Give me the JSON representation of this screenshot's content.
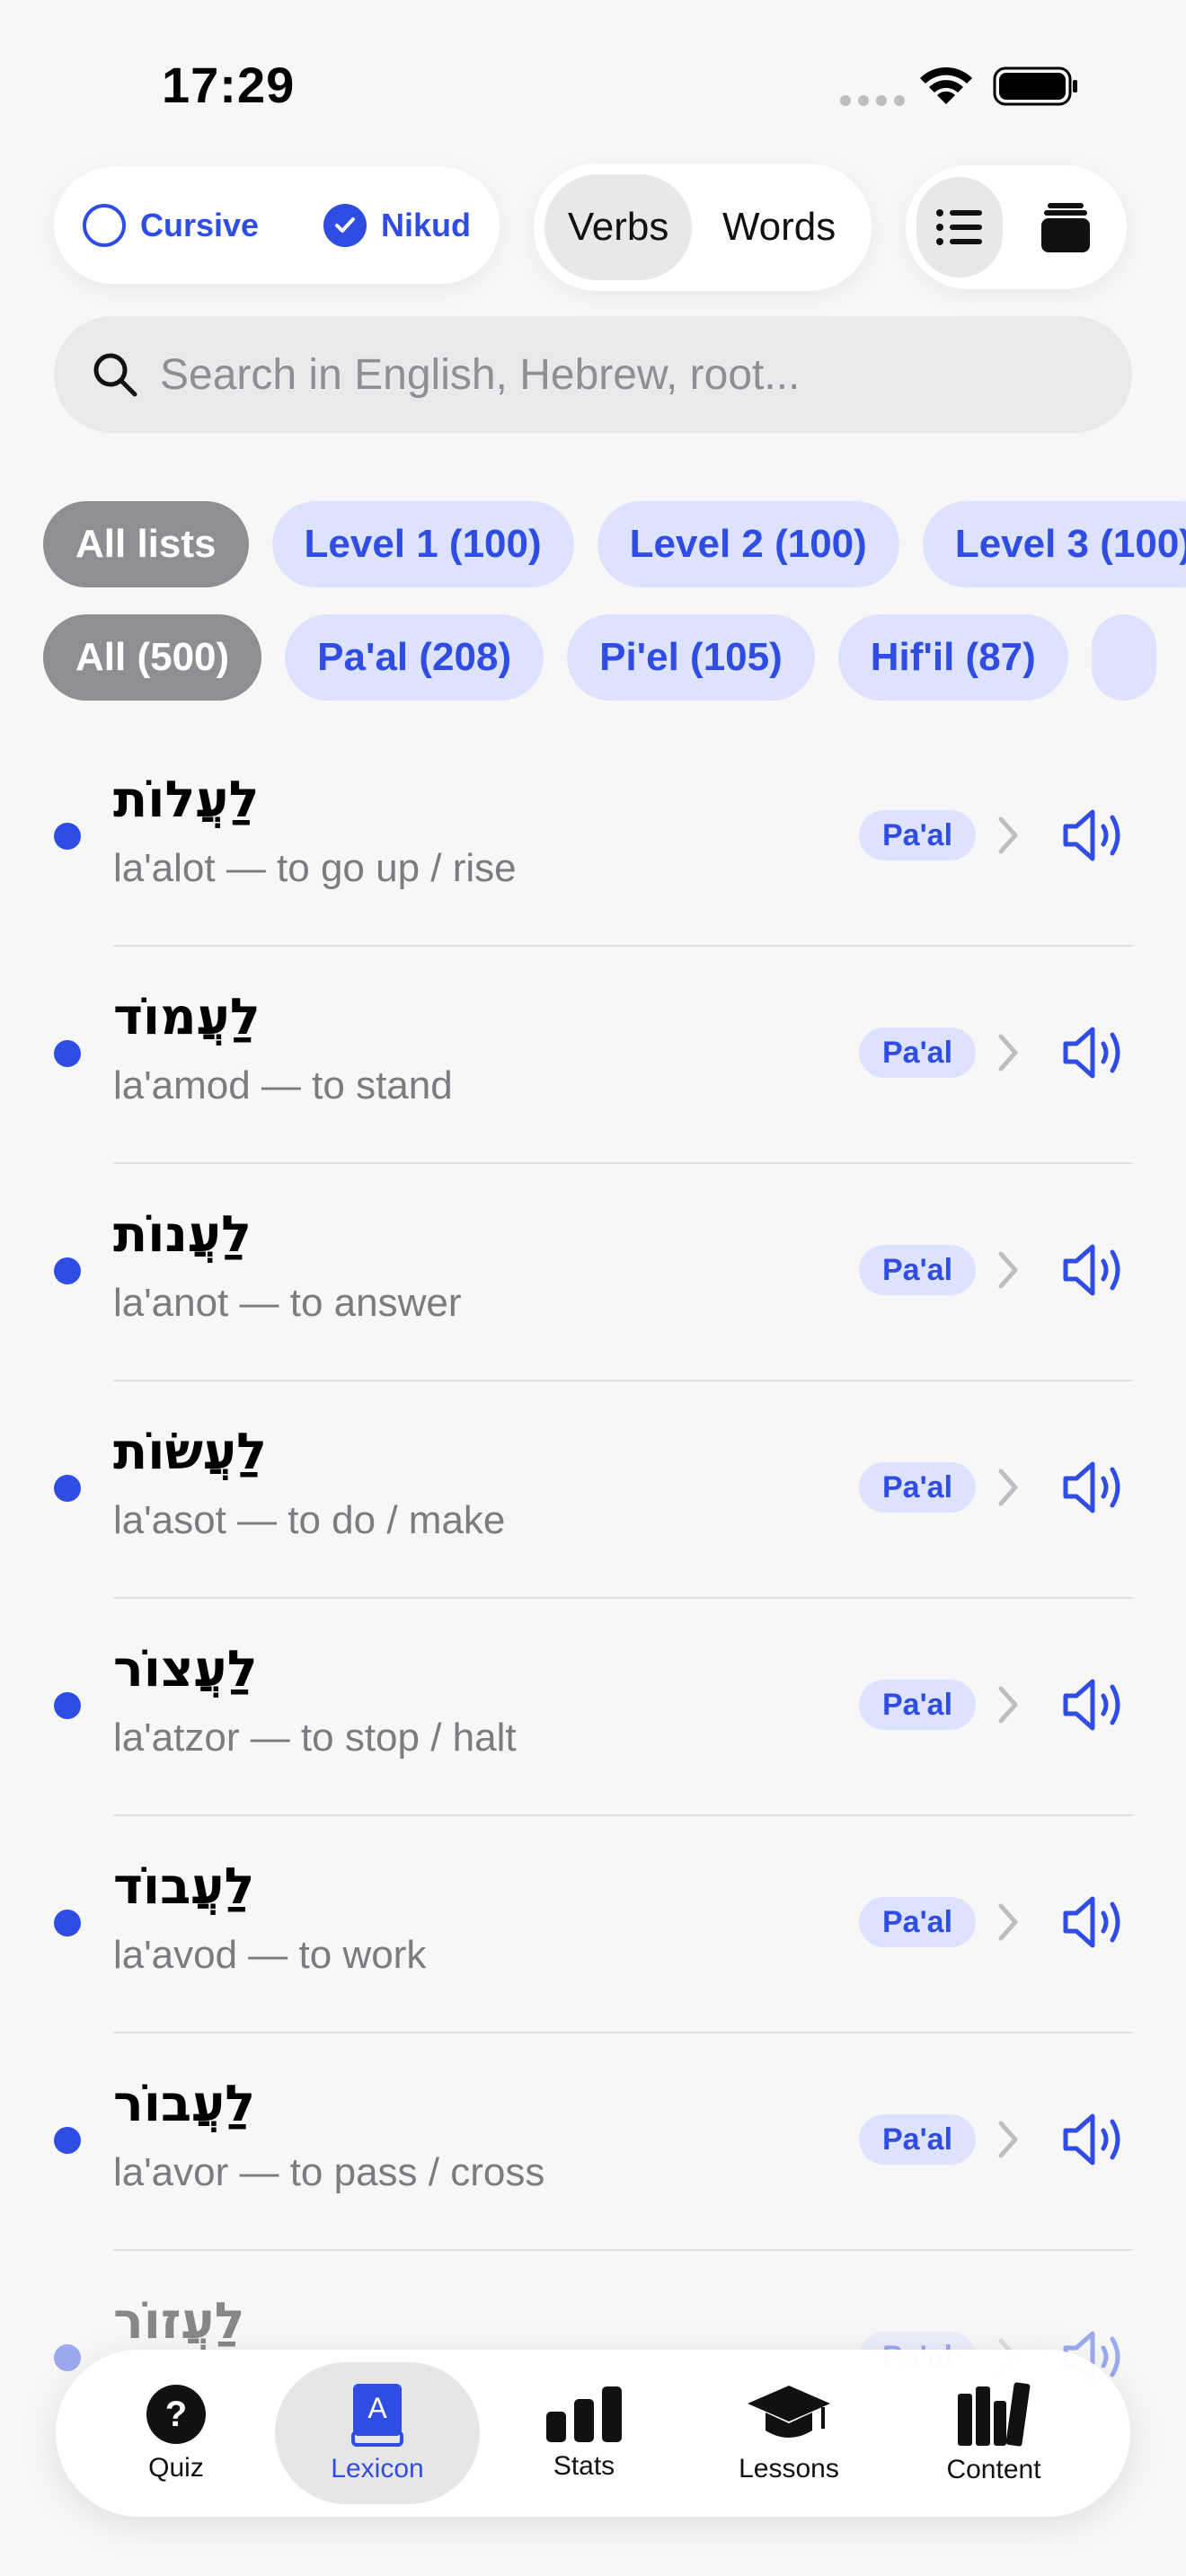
{
  "status_bar": {
    "time": "17:29"
  },
  "header": {
    "toggles": [
      {
        "label": "Cursive",
        "checked": false
      },
      {
        "label": "Nikud",
        "checked": true
      }
    ],
    "segments": [
      {
        "label": "Verbs",
        "selected": true
      },
      {
        "label": "Words",
        "selected": false
      }
    ]
  },
  "search": {
    "placeholder": "Search in English, Hebrew, root..."
  },
  "list_chips": [
    {
      "label": "All lists",
      "selected": true
    },
    {
      "label": "Level 1 (100)",
      "selected": false
    },
    {
      "label": "Level 2 (100)",
      "selected": false
    },
    {
      "label": "Level 3 (100)",
      "selected": false
    }
  ],
  "binyan_chips": [
    {
      "label": "All (500)",
      "selected": true
    },
    {
      "label": "Pa'al (208)",
      "selected": false
    },
    {
      "label": "Pi'el (105)",
      "selected": false
    },
    {
      "label": "Hif'il (87)",
      "selected": false
    },
    {
      "label": "",
      "selected": false
    }
  ],
  "words": [
    {
      "hebrew": "לַעֲלוֹת",
      "translit": "la'alot — to go up / rise",
      "binyan": "Pa'al"
    },
    {
      "hebrew": "לַעֲמוֹד",
      "translit": "la'amod — to stand",
      "binyan": "Pa'al"
    },
    {
      "hebrew": "לַעֲנוֹת",
      "translit": "la'anot — to answer",
      "binyan": "Pa'al"
    },
    {
      "hebrew": "לַעֲשׂוֹת",
      "translit": "la'asot — to do / make",
      "binyan": "Pa'al"
    },
    {
      "hebrew": "לַעֲצוֹר",
      "translit": "la'atzor — to stop / halt",
      "binyan": "Pa'al"
    },
    {
      "hebrew": "לַעֲבוֹד",
      "translit": "la'avod — to work",
      "binyan": "Pa'al"
    },
    {
      "hebrew": "לַעֲבוֹר",
      "translit": "la'avor — to pass / cross",
      "binyan": "Pa'al"
    },
    {
      "hebrew": "לַעֲזוֹר",
      "translit": "",
      "binyan": "Pa'al"
    }
  ],
  "tabs": [
    {
      "label": "Quiz",
      "active": false
    },
    {
      "label": "Lexicon",
      "active": true
    },
    {
      "label": "Stats",
      "active": false
    },
    {
      "label": "Lessons",
      "active": false
    },
    {
      "label": "Content",
      "active": false
    }
  ],
  "colors": {
    "accent": "#2f4ce3",
    "chip_bg": "#dde3ff",
    "selected_chip": "#8e8e93"
  }
}
